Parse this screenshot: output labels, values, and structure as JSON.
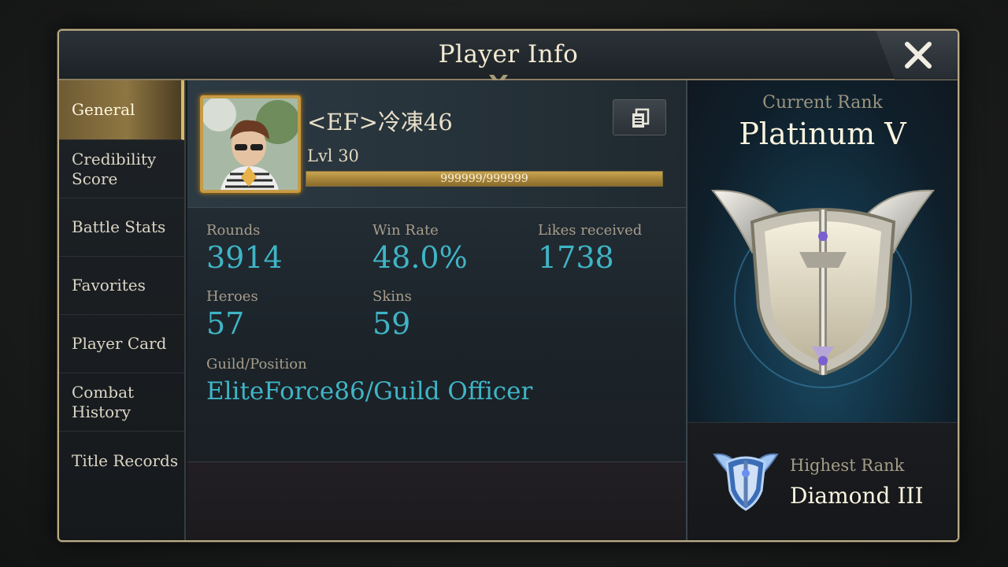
{
  "window": {
    "title": "Player Info",
    "close_icon": "close-icon"
  },
  "sidebar": {
    "items": [
      {
        "label": "General",
        "active": true
      },
      {
        "label": "Credibility Score",
        "active": false
      },
      {
        "label": "Battle Stats",
        "active": false
      },
      {
        "label": "Favorites",
        "active": false
      },
      {
        "label": "Player Card",
        "active": false
      },
      {
        "label": "Combat History",
        "active": false
      },
      {
        "label": "Title Records",
        "active": false
      }
    ]
  },
  "profile": {
    "name": "<EF>冷凍46",
    "level": "Lvl 30",
    "xp_text": "999999/999999",
    "xp_fraction": 1.0,
    "copy_icon": "copy-icon"
  },
  "stats": {
    "rounds_label": "Rounds",
    "rounds_value": "3914",
    "winrate_label": "Win Rate",
    "winrate_value": "48.0%",
    "likes_label": "Likes received",
    "likes_value": "1738",
    "heroes_label": "Heroes",
    "heroes_value": "57",
    "skins_label": "Skins",
    "skins_value": "59",
    "guild_label": "Guild/Position",
    "guild_value": "EliteForce86/Guild Officer"
  },
  "rank": {
    "current_label": "Current Rank",
    "current_value": "Platinum V",
    "highest_label": "Highest Rank",
    "highest_value": "Diamond III"
  },
  "colors": {
    "accent_gold": "#c79b46",
    "stat_cyan": "#3fb5c6",
    "title_text": "#f3ead2"
  }
}
